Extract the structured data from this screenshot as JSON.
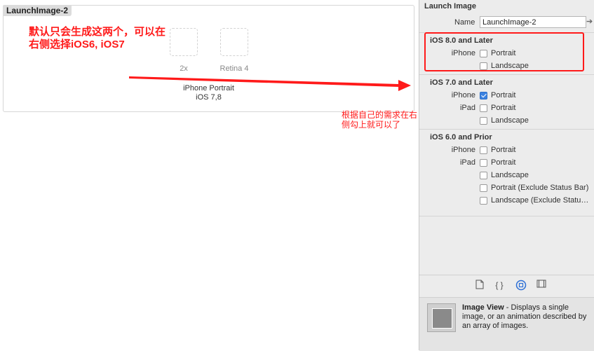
{
  "canvas": {
    "set_title": "LaunchImage-2",
    "slots": [
      {
        "label": "2x"
      },
      {
        "label": "Retina 4"
      }
    ],
    "group_caption_line1": "iPhone Portrait",
    "group_caption_line2": "iOS 7,8",
    "note_main": "默认只会生成这两个，可以在右侧选择iOS6, iOS7",
    "note_right": "根据自己的需求在右侧勾上就可以了"
  },
  "inspector": {
    "title": "Launch Image",
    "name_label": "Name",
    "name_value": "LaunchImage-2",
    "sections": [
      {
        "title": "iOS 8.0 and Later",
        "rows": [
          {
            "device": "iPhone",
            "option": "Portrait",
            "checked": false
          },
          {
            "device": "",
            "option": "Landscape",
            "checked": false
          }
        ]
      },
      {
        "title": "iOS 7.0 and Later",
        "rows": [
          {
            "device": "iPhone",
            "option": "Portrait",
            "checked": true
          },
          {
            "device": "iPad",
            "option": "Portrait",
            "checked": false
          },
          {
            "device": "",
            "option": "Landscape",
            "checked": false
          }
        ]
      },
      {
        "title": "iOS 6.0 and Prior",
        "rows": [
          {
            "device": "iPhone",
            "option": "Portrait",
            "checked": false
          },
          {
            "device": "iPad",
            "option": "Portrait",
            "checked": false
          },
          {
            "device": "",
            "option": "Landscape",
            "checked": false
          },
          {
            "device": "",
            "option": "Portrait (Exclude Status Bar)",
            "checked": false
          },
          {
            "device": "",
            "option": "Landscape (Exclude Statu…",
            "checked": false
          }
        ]
      }
    ],
    "library_tabs": [
      "file-template-icon",
      "code-snippet-icon",
      "object-library-icon",
      "media-library-icon"
    ],
    "library_item": {
      "name": "Image View",
      "description": " - Displays a single image, or an animation described by an array of images."
    },
    "accent_color": "#2c6fd6",
    "annotation_color": "#ff1a1a"
  }
}
